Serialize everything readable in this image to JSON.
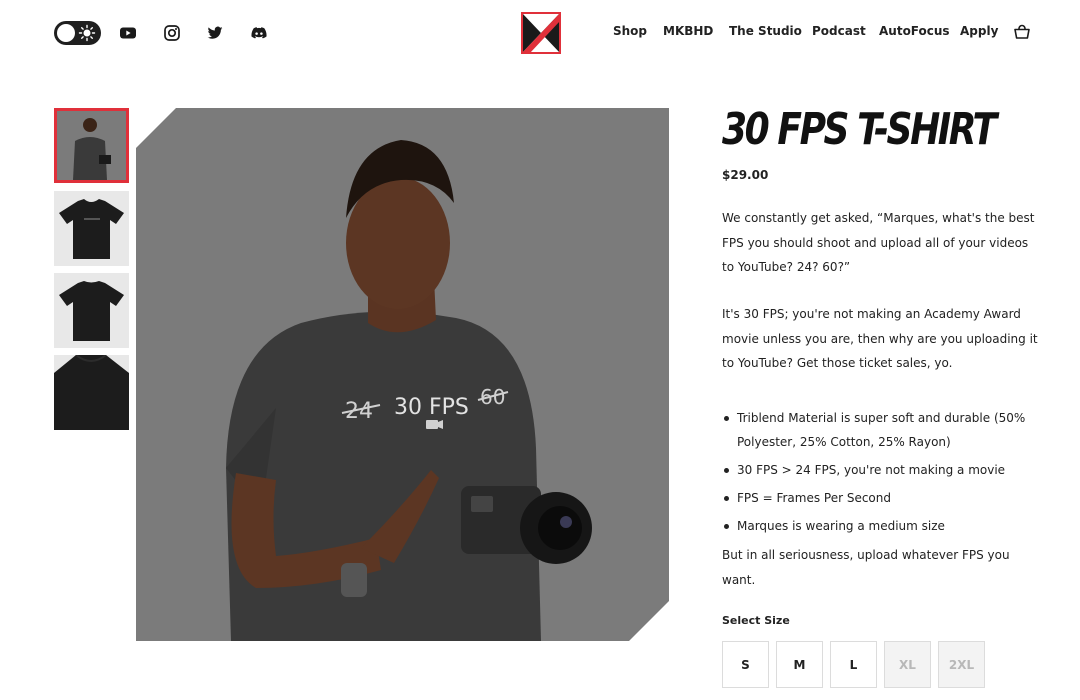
{
  "header": {
    "nav": [
      "Shop",
      "MKBHD",
      "The Studio",
      "Podcast",
      "AutoFocus",
      "Apply"
    ],
    "icons": [
      "theme-toggle",
      "youtube-icon",
      "instagram-icon",
      "twitter-icon",
      "discord-icon",
      "logo-mark",
      "cart-icon"
    ]
  },
  "product": {
    "title": "30 FPS T-SHIRT",
    "price": "$29.00",
    "description": [
      "We constantly get asked, “Marques, what's the best FPS you should shoot and upload all of your videos to YouTube? 24? 60?”",
      "It's 30 FPS; you're not making an Academy Award movie unless you are, then why are you uploading it to YouTube? Get those ticket sales, yo."
    ],
    "features": [
      "Triblend Material is super soft and durable (50% Polyester, 25% Cotton, 25% Rayon)",
      "30 FPS > 24 FPS, you're not making a movie",
      "FPS = Frames Per Second",
      "Marques is wearing a medium size"
    ],
    "closing": "But in all seriousness, upload whatever FPS you want.",
    "shirt_print": {
      "left": "24",
      "center": "30 FPS",
      "right": "60"
    }
  },
  "size": {
    "label": "Select Size",
    "options": [
      {
        "label": "S",
        "available": true
      },
      {
        "label": "M",
        "available": true
      },
      {
        "label": "L",
        "available": true
      },
      {
        "label": "XL",
        "available": false
      },
      {
        "label": "2XL",
        "available": false
      }
    ]
  },
  "colors": {
    "accent": "#e0303a",
    "dark": "#1f1f1f",
    "photo_bg": "#7b7b7b",
    "shirt": "#3a3a3a"
  }
}
